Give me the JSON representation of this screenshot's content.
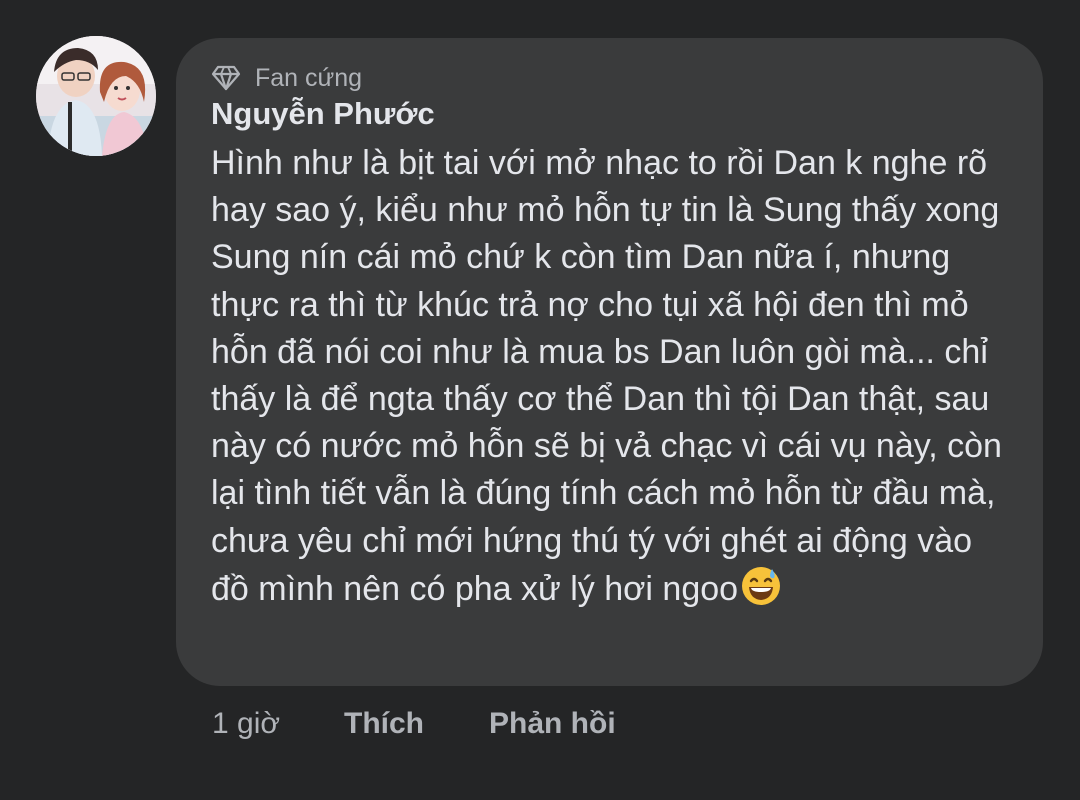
{
  "comment": {
    "badge": {
      "icon": "diamond-icon",
      "label": "Fan cứng"
    },
    "author": "Nguyễn Phước",
    "text": "Hình như là bịt tai với mở nhạc to rồi Dan k nghe rõ hay sao ý, kiểu như mỏ hỗn tự tin là Sung thấy xong Sung nín cái mỏ chứ k còn tìm Dan nữa í, nhưng thực ra thì từ khúc trả nợ cho tụi xã hội đen thì mỏ hỗn đã nói coi như là mua bs Dan luôn gòi mà... chỉ thấy là để ngta thấy cơ thể Dan thì tội Dan thật, sau này có nước mỏ hỗn sẽ bị vả chạc vì cái vụ này, còn lại tình tiết vẫn là đúng tính cách mỏ hỗn từ đầu mà, chưa yêu chỉ mới hứng thú tý với ghét ai động vào đồ mình nên có pha xử lý hơi ngoo",
    "emoji": "grinning-face-with-sweat-icon",
    "avatar": "profile-photo-avatar"
  },
  "actions": {
    "time": "1 giờ",
    "like": "Thích",
    "reply": "Phản hồi"
  },
  "colors": {
    "background": "#242526",
    "bubble": "#3a3b3c",
    "primary_text": "#e4e6eb",
    "secondary_text": "#b0b3b8"
  }
}
